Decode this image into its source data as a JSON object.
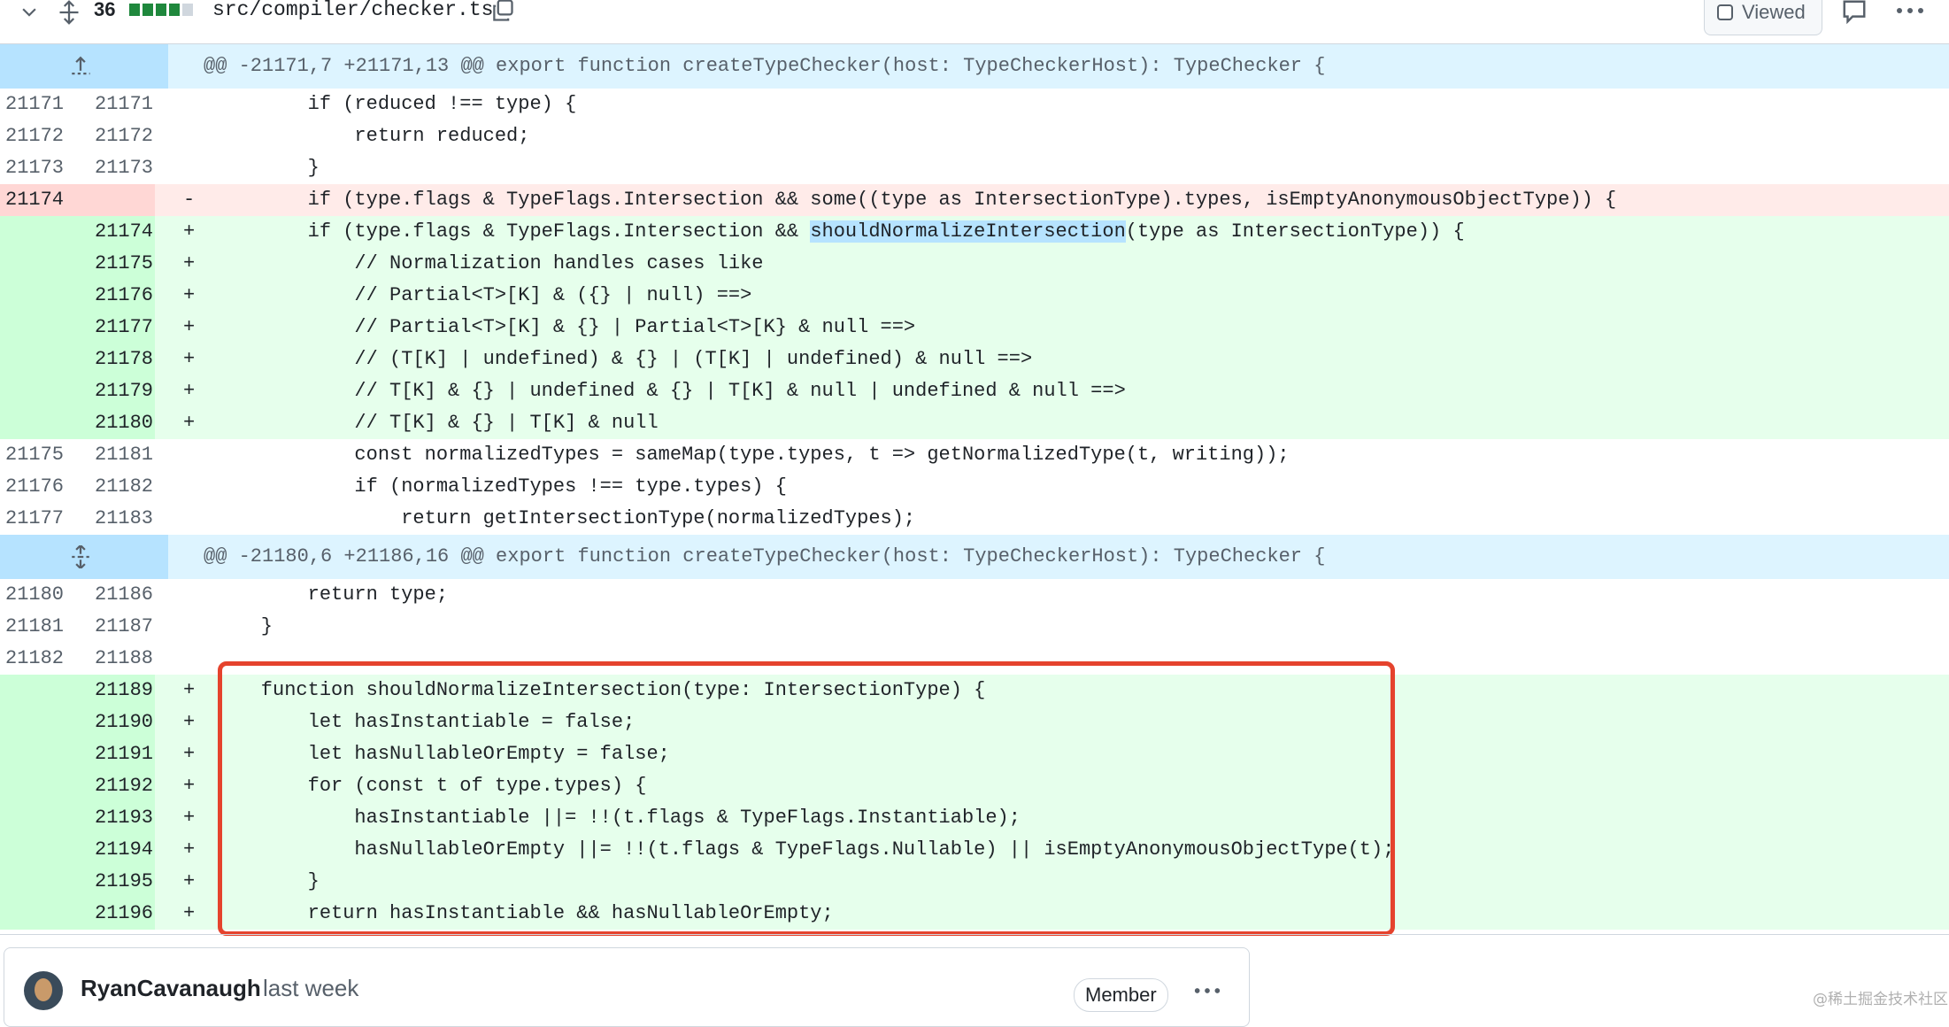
{
  "file": {
    "changes_count": "36",
    "path": "src/compiler/checker.ts",
    "viewed_label": "Viewed"
  },
  "hunks": [
    {
      "header": "@@ -21171,7 +21171,13 @@ export function createTypeChecker(host: TypeCheckerHost): TypeChecker {"
    },
    {
      "header": "@@ -21180,6 +21186,16 @@ export function createTypeChecker(host: TypeCheckerHost): TypeChecker {"
    }
  ],
  "lines": [
    {
      "old": "21171",
      "new": "21171",
      "sign": "",
      "code": "        if (reduced !== type) {"
    },
    {
      "old": "21172",
      "new": "21172",
      "sign": "",
      "code": "            return reduced;"
    },
    {
      "old": "21173",
      "new": "21173",
      "sign": "",
      "code": "        }"
    },
    {
      "old": "21174",
      "new": "",
      "sign": "-",
      "code": "        if (type.flags & TypeFlags.Intersection && some((type as IntersectionType).types, isEmptyAnonymousObjectType)) {"
    },
    {
      "old": "",
      "new": "21174",
      "sign": "+",
      "code_pre": "        if (type.flags & TypeFlags.Intersection && ",
      "code_hl": "shouldNormalizeIntersection",
      "code_post": "(type as IntersectionType)) {"
    },
    {
      "old": "",
      "new": "21175",
      "sign": "+",
      "code": "            // Normalization handles cases like"
    },
    {
      "old": "",
      "new": "21176",
      "sign": "+",
      "code": "            // Partial<T>[K] & ({} | null) ==>"
    },
    {
      "old": "",
      "new": "21177",
      "sign": "+",
      "code": "            // Partial<T>[K] & {} | Partial<T>[K} & null ==>"
    },
    {
      "old": "",
      "new": "21178",
      "sign": "+",
      "code": "            // (T[K] | undefined) & {} | (T[K] | undefined) & null ==>"
    },
    {
      "old": "",
      "new": "21179",
      "sign": "+",
      "code": "            // T[K] & {} | undefined & {} | T[K] & null | undefined & null ==>"
    },
    {
      "old": "",
      "new": "21180",
      "sign": "+",
      "code": "            // T[K] & {} | T[K] & null"
    },
    {
      "old": "21175",
      "new": "21181",
      "sign": "",
      "code": "            const normalizedTypes = sameMap(type.types, t => getNormalizedType(t, writing));"
    },
    {
      "old": "21176",
      "new": "21182",
      "sign": "",
      "code": "            if (normalizedTypes !== type.types) {"
    },
    {
      "old": "21177",
      "new": "21183",
      "sign": "",
      "code": "                return getIntersectionType(normalizedTypes);"
    }
  ],
  "lines2": [
    {
      "old": "21180",
      "new": "21186",
      "sign": "",
      "code": "        return type;"
    },
    {
      "old": "21181",
      "new": "21187",
      "sign": "",
      "code": "    }"
    },
    {
      "old": "21182",
      "new": "21188",
      "sign": "",
      "code": ""
    },
    {
      "old": "",
      "new": "21189",
      "sign": "+",
      "code": "    function shouldNormalizeIntersection(type: IntersectionType) {"
    },
    {
      "old": "",
      "new": "21190",
      "sign": "+",
      "code": "        let hasInstantiable = false;"
    },
    {
      "old": "",
      "new": "21191",
      "sign": "+",
      "code": "        let hasNullableOrEmpty = false;"
    },
    {
      "old": "",
      "new": "21192",
      "sign": "+",
      "code": "        for (const t of type.types) {"
    },
    {
      "old": "",
      "new": "21193",
      "sign": "+",
      "code": "            hasInstantiable ||= !!(t.flags & TypeFlags.Instantiable);"
    },
    {
      "old": "",
      "new": "21194",
      "sign": "+",
      "code": "            hasNullableOrEmpty ||= !!(t.flags & TypeFlags.Nullable) || isEmptyAnonymousObjectType(t);"
    },
    {
      "old": "",
      "new": "21195",
      "sign": "+",
      "code": "        }"
    },
    {
      "old": "",
      "new": "21196",
      "sign": "+",
      "code": "        return hasInstantiable && hasNullableOrEmpty;"
    }
  ],
  "comment": {
    "author": "RyanCavanaugh",
    "time": "last week",
    "badge": "Member"
  },
  "watermark": "@稀土掘金技术社区",
  "colors": {
    "add_bg": "#e6ffec",
    "add_gutter": "#ccffd8",
    "del_bg": "#ffebe9",
    "del_gutter": "#ffd7d5",
    "hunk_bg": "#ddf4ff",
    "highlight_border": "#e5432d"
  },
  "icons": [
    "chevron-down-icon",
    "expand-icon",
    "copy-icon",
    "comment-icon",
    "kebab-icon",
    "unfold-up-icon",
    "unfold-both-icon"
  ]
}
